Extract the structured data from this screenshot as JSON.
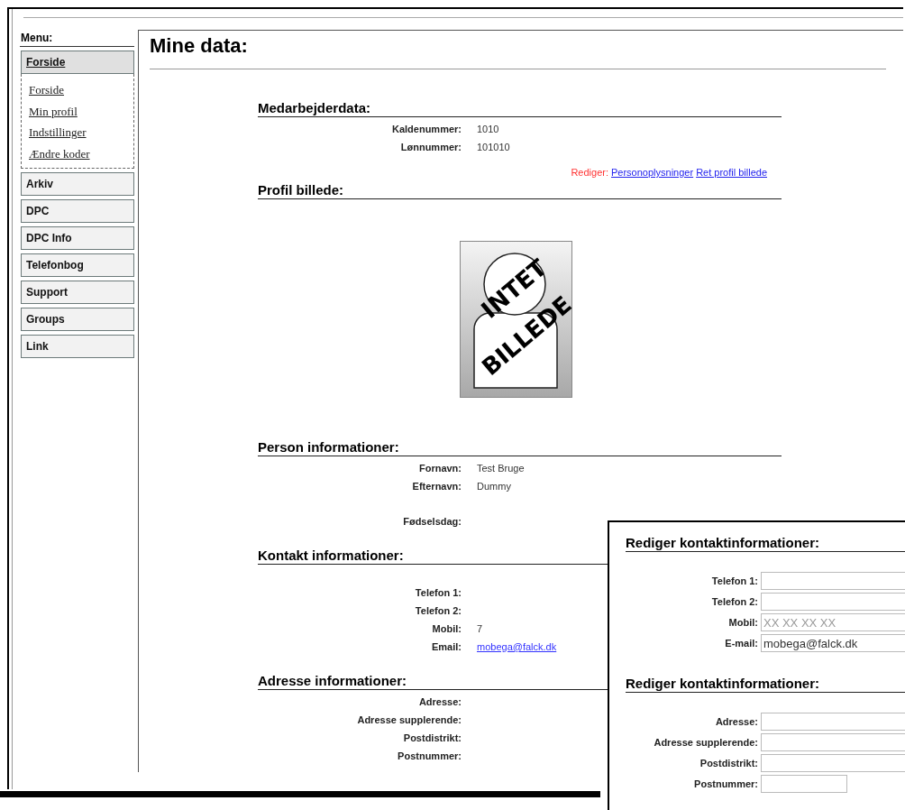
{
  "sidebar": {
    "title": "Menu:",
    "items": [
      {
        "label": "Forside",
        "selected": true,
        "children": [
          {
            "label": "Forside"
          },
          {
            "label": "Min profil"
          },
          {
            "label": "Indstillinger"
          },
          {
            "label": "Ændre koder"
          }
        ]
      },
      {
        "label": "Arkiv",
        "selected": false
      },
      {
        "label": "DPC",
        "selected": false
      },
      {
        "label": "DPC Info",
        "selected": false
      },
      {
        "label": "Telefonbog",
        "selected": false
      },
      {
        "label": "Support",
        "selected": false
      },
      {
        "label": "Groups",
        "selected": false
      },
      {
        "label": "Link",
        "selected": false
      }
    ]
  },
  "page": {
    "title": "Mine data:"
  },
  "sections": [
    {
      "heading": "Medarbejderdata:",
      "row_groups": [
        [
          {
            "label": "Kaldenummer:",
            "value": "1010"
          },
          {
            "label": "Lønnummer:",
            "value": "101010"
          }
        ]
      ],
      "edit_links": {
        "label": "Rediger:",
        "links": [
          "Personoplysninger",
          "Ret profil billede"
        ]
      }
    },
    {
      "heading": "Profil billede:",
      "placeholder_image": {
        "lines": [
          "INTET",
          "BILLEDE"
        ]
      }
    },
    {
      "heading": "Person informationer:",
      "row_groups": [
        [
          {
            "label": "Fornavn:",
            "value": "Test Bruge"
          },
          {
            "label": "Efternavn:",
            "value": "Dummy"
          }
        ],
        [
          {
            "label": "Fødselsdag:"
          }
        ]
      ]
    },
    {
      "heading": "Kontakt informationer:",
      "row_groups": [
        [
          {
            "label": "Telefon 1:"
          },
          {
            "label": "Telefon 2:"
          },
          {
            "label": "Mobil:",
            "value": "7"
          },
          {
            "label": "Email:",
            "value": "mobega@falck.dk",
            "kind": "link"
          }
        ]
      ]
    },
    {
      "heading": "Adresse informationer:",
      "row_groups": [
        [
          {
            "label": "Adresse:"
          },
          {
            "label": "Adresse supplerende:"
          },
          {
            "label": "Postdistrikt:"
          },
          {
            "label": "Postnummer:"
          }
        ]
      ]
    }
  ],
  "edit_panel": {
    "sections": [
      {
        "heading": "Rediger kontaktinformationer:",
        "fields": [
          {
            "label": "Telefon 1:",
            "kind": "wide"
          },
          {
            "label": "Telefon 2:",
            "kind": "wide"
          },
          {
            "label": "Mobil:",
            "kind": "wide",
            "placeholder": "XX XX XX XX"
          },
          {
            "label": "E-mail:",
            "kind": "wide",
            "value": "mobega@falck.dk"
          }
        ]
      },
      {
        "heading": "Rediger kontaktinformationer:",
        "fields": [
          {
            "label": "Adresse:",
            "kind": "wide"
          },
          {
            "label": "Adresse supplerende:",
            "kind": "wide"
          },
          {
            "label": "Postdistrikt:",
            "kind": "wide"
          },
          {
            "label": "Postnummer:",
            "kind": "short"
          }
        ]
      }
    ]
  }
}
